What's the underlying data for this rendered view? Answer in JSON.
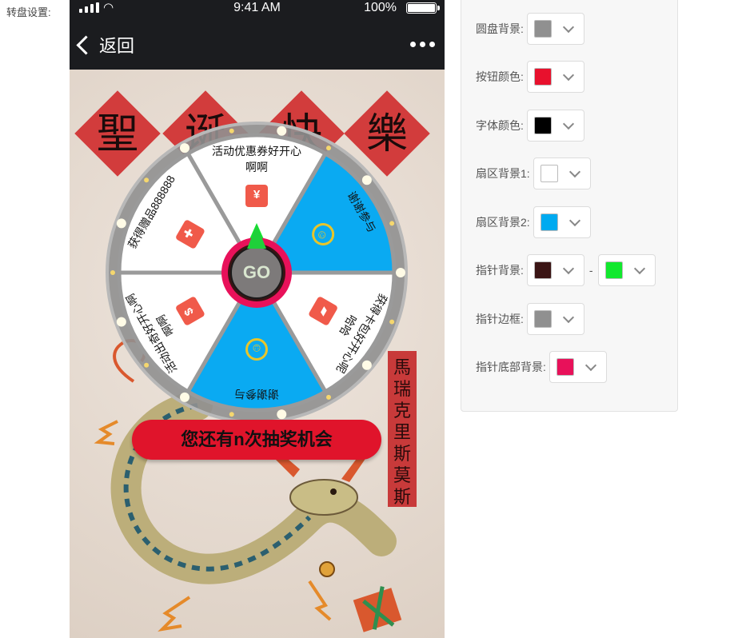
{
  "page": {
    "section_label": "转盘设置:"
  },
  "phone": {
    "status": {
      "time": "9:41 AM",
      "battery": "100%"
    },
    "nav": {
      "back_label": "返回"
    },
    "banner_chars": [
      "聖",
      "诞",
      "快",
      "樂"
    ],
    "vertical_tag": "馬瑞克里斯莫斯",
    "wheel": {
      "center_label": "GO",
      "segments": [
        {
          "line1": "活动优惠券好开心",
          "line2": "啊啊",
          "icon": "coupon-icon",
          "color": "#ffffff"
        },
        {
          "line1": "谢谢参与",
          "line2": "",
          "icon": "smile-icon",
          "color": "#0aaaf2"
        },
        {
          "line1": "获得卡包好开心呢",
          "line2": "哈哈",
          "icon": "gift-card-icon",
          "color": "#ffffff"
        },
        {
          "line1": "谢谢参与",
          "line2": "",
          "icon": "smile-icon",
          "color": "#0aaaf2"
        },
        {
          "line1": "活动出奇好开心啊",
          "line2": "啊啊",
          "icon": "money-bag-icon",
          "color": "#ffffff"
        },
        {
          "line1": "获得赠品888888",
          "line2": "",
          "icon": "gift-box-icon",
          "color": "#ffffff"
        }
      ]
    },
    "chance_button": "您还有n次抽奖机会"
  },
  "settings": [
    {
      "label": "圆盘背景:",
      "colors": [
        "#909090"
      ]
    },
    {
      "label": "按钮颜色:",
      "colors": [
        "#e8112d"
      ]
    },
    {
      "label": "字体颜色:",
      "colors": [
        "#000000"
      ]
    },
    {
      "label": "扇区背景1:",
      "colors": [
        "#ffffff"
      ]
    },
    {
      "label": "扇区背景2:",
      "colors": [
        "#00aaf0"
      ]
    },
    {
      "label": "指针背景:",
      "colors": [
        "#3a1414",
        "#12e82e"
      ],
      "separator": "-"
    },
    {
      "label": "指针边框:",
      "colors": [
        "#909090"
      ]
    },
    {
      "label": "指针底部背景:",
      "colors": [
        "#e8115a"
      ]
    }
  ]
}
